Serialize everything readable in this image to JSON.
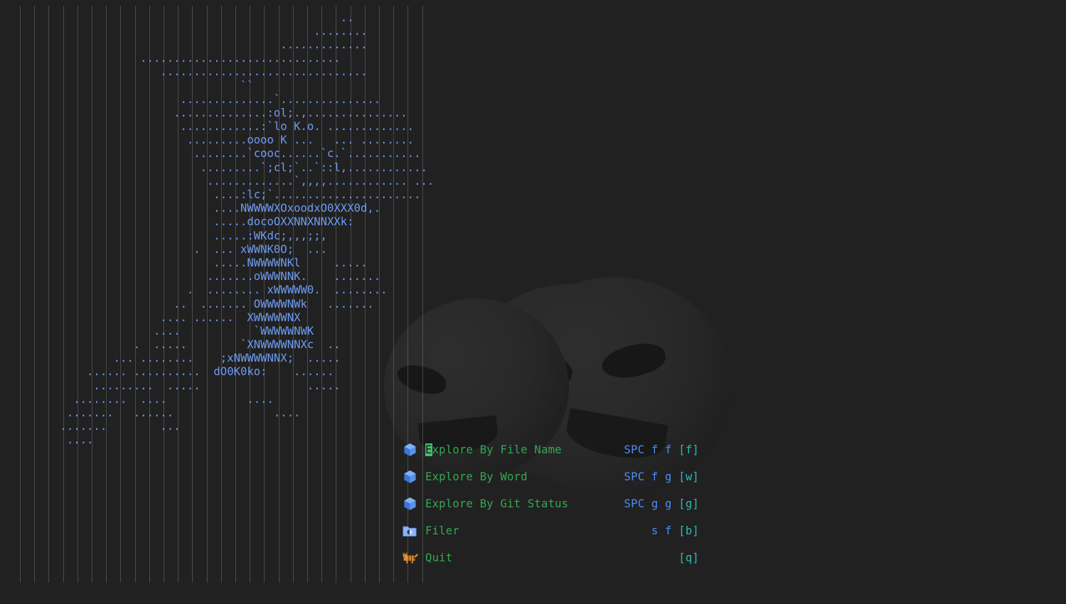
{
  "theme": {
    "background": "#212121",
    "ascii_color": "#6f9bf2",
    "menu_label_color": "#34a853",
    "cursor_highlight_bg": "#3ec46d",
    "key_sequence_color": "#4a8df8",
    "key_bracket_color": "#2fb8b0",
    "guide_color": "#6d6d6d"
  },
  "ascii_art": {
    "name": "neovim-logo-ascii-banner",
    "lines": [
      "                                                   ..",
      "                                               ........",
      "                                          .............",
      "                     ..............................",
      "                        ...............................",
      "                                    ``",
      "                           ..............`...............",
      "                          ..............:ol;.,...............",
      "                           ............:`lo K.o. .............",
      "                            .........oooo K ...   ... ........",
      "                             ........`cooc......`c.`...........",
      "                              .........`;cl;`..`::l,............",
      "                               .............`,,,,............ ...",
      "                                ....:lc;`......................",
      "                                ....NWWWWXOxoodxO0XXX0d,.",
      "                                .....docoOXXNNXNNXXk:",
      "                                .....:WKdc;,,,;;,",
      "                             .  ... xWWNK0O;  ...",
      "                                .....NWWWWNKl     .....",
      "                               .......oWWWNNK.    .......",
      "                            .  ........ xWWWWW0.  ........",
      "                          ..  ....... OWWWWNWk   .......",
      "                        .... ......  XWWWWWNX",
      "                       ....           `WWWWWNWK",
      "                    .  .....        `XNWWWWNNXc  ..",
      "                 ... ........    ;xNWWWWNNX;  .....",
      "             ...... ..........  dO0K0ko:    ......",
      "              .........  .....                .....",
      "           ........  ....            ....",
      "          .......   ......               ....",
      "         .......        ...",
      "          ...."
    ]
  },
  "menu": {
    "items": [
      {
        "icon": "cube-icon",
        "label_prefix": "E",
        "label_rest": "xplore By File Name",
        "keys_sequence": "SPC f f",
        "keys_bracket": "[f]",
        "selected": true
      },
      {
        "icon": "cube-icon",
        "label_prefix": "",
        "label_rest": "Explore By Word",
        "keys_sequence": "SPC f g",
        "keys_bracket": "[w]",
        "selected": false
      },
      {
        "icon": "cube-icon",
        "label_prefix": "",
        "label_rest": "Explore By Git Status",
        "keys_sequence": "SPC g g",
        "keys_bracket": "[g]",
        "selected": false
      },
      {
        "icon": "folder-icon",
        "label_prefix": "",
        "label_rest": "Filer",
        "keys_sequence": "s f",
        "keys_bracket": "[b]",
        "selected": false
      },
      {
        "icon": "tiger-icon",
        "label_prefix": "",
        "label_rest": "Quit",
        "keys_sequence": "",
        "keys_bracket": "[q]",
        "selected": false
      }
    ]
  }
}
